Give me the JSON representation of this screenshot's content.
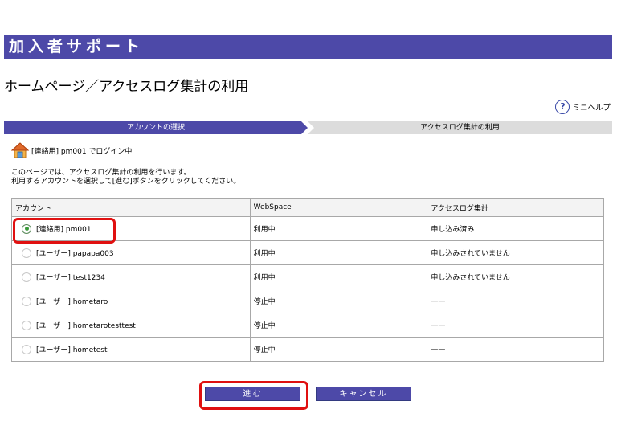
{
  "header": {
    "banner_title": "加入者サポート",
    "page_title": "ホームページ／アクセスログ集計の利用",
    "mini_help_label": "ミニヘルプ"
  },
  "steps": [
    {
      "label": "アカウントの選択",
      "active": true
    },
    {
      "label": "アクセスログ集計の利用",
      "active": false
    }
  ],
  "login_status": "[連絡用] pm001 でログイン中",
  "instructions": [
    "このページでは、アクセスログ集計の利用を行います。",
    "利用するアカウントを選択して[進む]ボタンをクリックしてください。"
  ],
  "table": {
    "headers": [
      "アカウント",
      "WebSpace",
      "アクセスログ集計"
    ],
    "rows": [
      {
        "account": "[連絡用] pm001",
        "webspace": "利用中",
        "accesslog": "申し込み済み",
        "selected": true
      },
      {
        "account": "[ユーザー] papapa003",
        "webspace": "利用中",
        "accesslog": "申し込みされていません",
        "selected": false
      },
      {
        "account": "[ユーザー] test1234",
        "webspace": "利用中",
        "accesslog": "申し込みされていません",
        "selected": false
      },
      {
        "account": "[ユーザー] hometaro",
        "webspace": "停止中",
        "accesslog": "——",
        "selected": false
      },
      {
        "account": "[ユーザー] hometarotesttest",
        "webspace": "停止中",
        "accesslog": "——",
        "selected": false
      },
      {
        "account": "[ユーザー] hometest",
        "webspace": "停止中",
        "accesslog": "——",
        "selected": false
      }
    ]
  },
  "buttons": {
    "next_label": "進む",
    "cancel_label": "キャンセル"
  },
  "colors": {
    "brand": "#4d49a8",
    "highlight": "#e01010"
  }
}
